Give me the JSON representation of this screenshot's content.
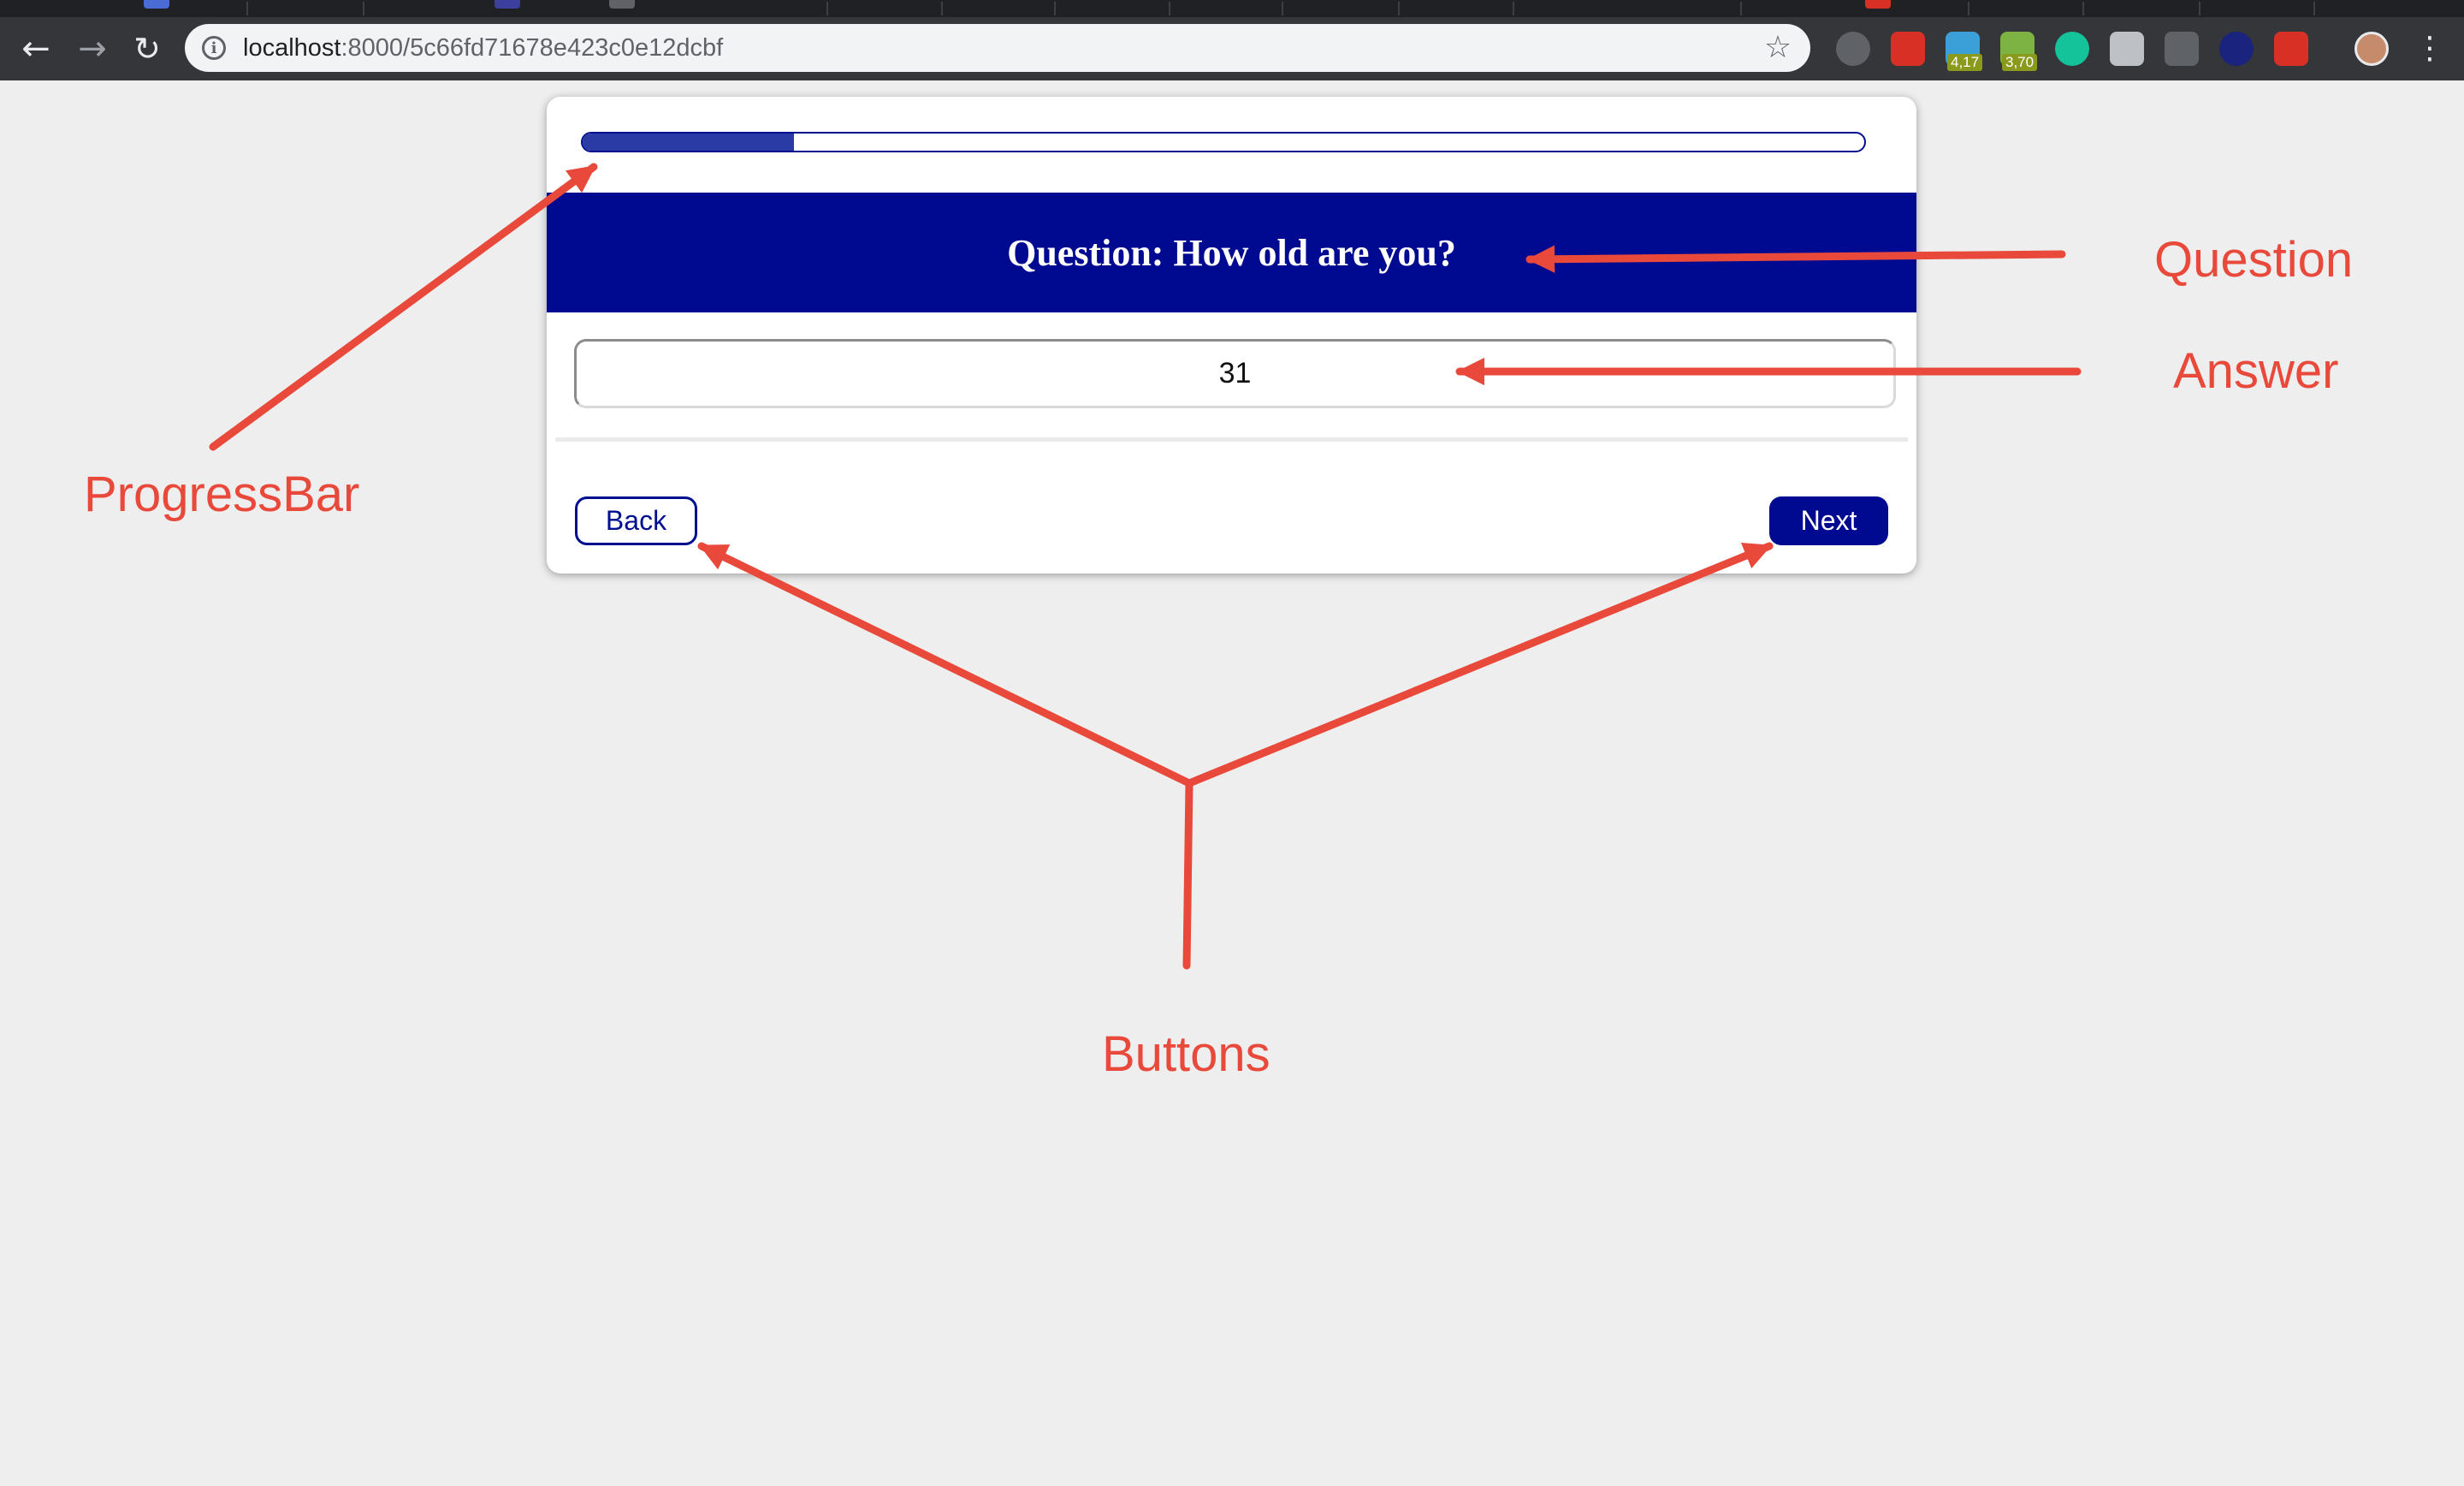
{
  "browser": {
    "url_host": "localhost",
    "url_path": ":8000/5c66fd71678e423c0e12dcbf",
    "extensions": [
      {
        "name": "contrast-icon",
        "color": "#5f6368"
      },
      {
        "name": "extension-red-icon",
        "color": "#d93025"
      },
      {
        "name": "extension-blue-badge-icon",
        "color": "#3b9fd8",
        "badge": "4,17"
      },
      {
        "name": "android-icon",
        "color": "#7cb342",
        "badge": "3,70"
      },
      {
        "name": "grammarly-icon",
        "color": "#15c39a"
      },
      {
        "name": "chat-icon",
        "color": "#bdc1c6"
      },
      {
        "name": "bookmark-icon",
        "color": "#5f6368"
      },
      {
        "name": "target-icon",
        "color": "#1a237e"
      },
      {
        "name": "extension-menu-red-icon",
        "color": "#d93025"
      }
    ]
  },
  "survey": {
    "progress": 0.165,
    "question": "Question: How old are you?",
    "answer": "31",
    "back_label": "Back",
    "next_label": "Next"
  },
  "annotations": {
    "progress_bar": "ProgressBar",
    "question": "Question",
    "answer": "Answer",
    "buttons": "Buttons",
    "color": "#e8493a"
  }
}
